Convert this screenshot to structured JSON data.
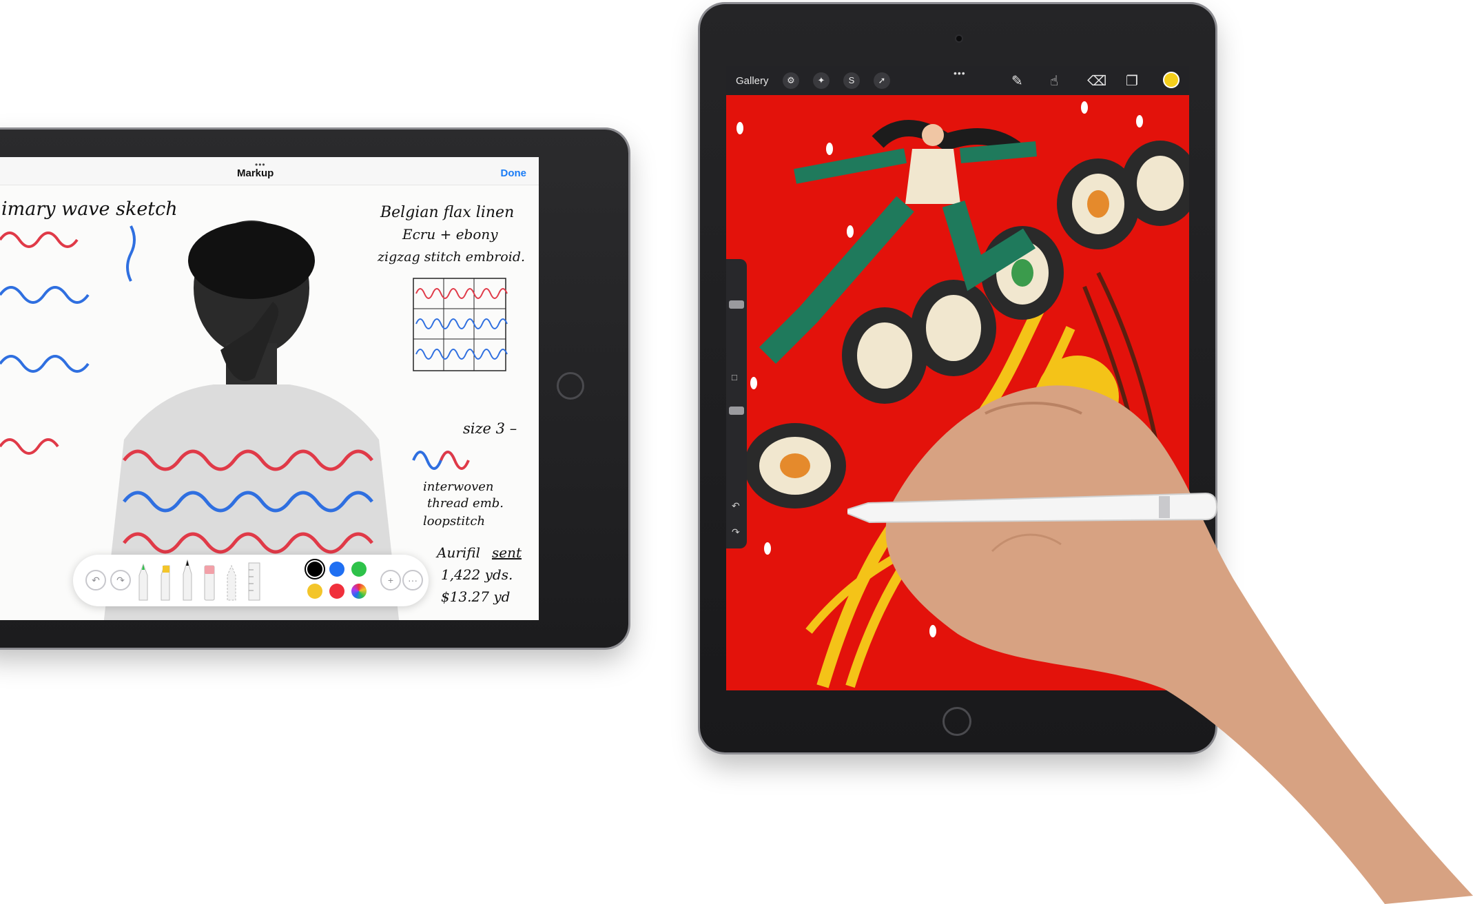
{
  "left_ipad": {
    "markup_bar": {
      "dots": "•••",
      "title": "Markup",
      "done_label": "Done"
    },
    "handwriting": {
      "sketch_title": "imary wave sketch",
      "notes": [
        "Belgian flax linen",
        "Ecru + ebony",
        "zigzag stitch embroid.",
        "size 3 –",
        "interwoven",
        "thread emb.",
        "loopstitch",
        "Aurifil",
        "sent",
        "1,422 yds.",
        "$13.27 yd"
      ]
    },
    "toolbar": {
      "tools": [
        "undo-icon",
        "redo-icon",
        "pen",
        "marker",
        "pencil",
        "eraser",
        "lasso",
        "ruler"
      ],
      "colors": [
        "#000000",
        "#1f6ff2",
        "#2ec24a",
        "#f3c52a",
        "#f0303c",
        "multicolor"
      ],
      "add_label": "+",
      "more_label": "···"
    }
  },
  "right_ipad": {
    "app_bar": {
      "gallery_label": "Gallery",
      "dots": "•••",
      "left_tools": [
        "wrench-icon",
        "magic-wand-icon",
        "selection-icon",
        "arrow-icon"
      ],
      "right_tools": [
        "brush-icon",
        "smudge-icon",
        "eraser-icon",
        "layers-icon"
      ],
      "active_color": "#f4cf1c"
    },
    "canvas_background": "#e3120b",
    "side_slider": {
      "undo_label": "↶",
      "redo_label": "↷",
      "square_label": "□"
    }
  }
}
